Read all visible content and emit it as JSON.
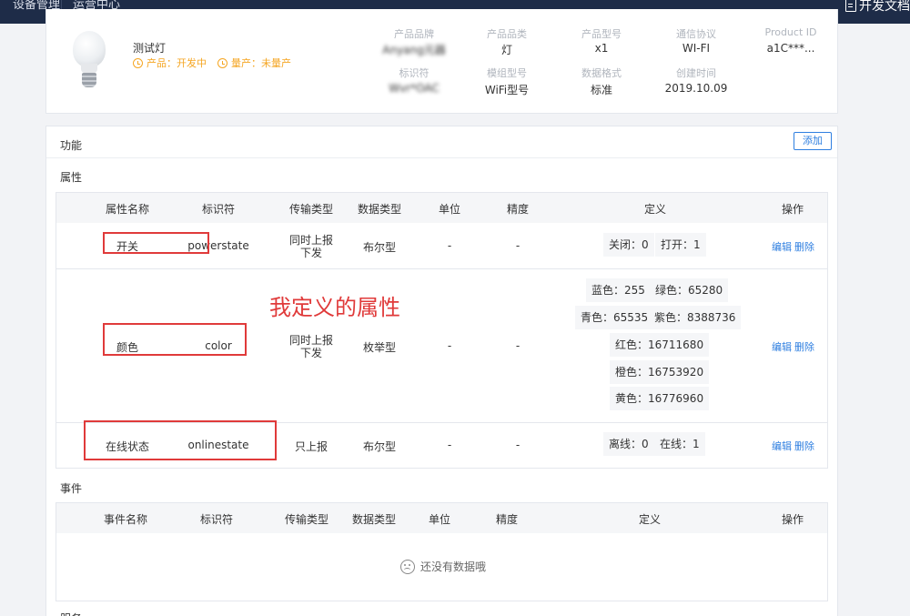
{
  "topbar": {
    "nav": [
      "设备管理",
      "运营中心"
    ],
    "doc_link": "开发文档"
  },
  "product": {
    "name": "测试灯",
    "status": [
      {
        "label": "产品：开发中"
      },
      {
        "label": "量产：未量产"
      }
    ],
    "meta": [
      {
        "label": "产品品牌",
        "value": "Anyang元器"
      },
      {
        "label": "产品品类",
        "value": "灯"
      },
      {
        "label": "产品型号",
        "value": "x1"
      },
      {
        "label": "通信协议",
        "value": "WI-FI"
      },
      {
        "label": "Product ID",
        "value": "a1C***..."
      },
      {
        "label": "标识符",
        "value": "Wvr*OAC"
      },
      {
        "label": "模组型号",
        "value": "WiFi型号"
      },
      {
        "label": "数据格式",
        "value": "标准"
      },
      {
        "label": "创建时间",
        "value": "2019.10.09"
      }
    ]
  },
  "functions": {
    "title": "功能",
    "add_label": "添加",
    "annotation": "我定义的属性",
    "properties": {
      "section": "属性",
      "headers": [
        "属性名称",
        "标识符",
        "传输类型",
        "数据类型",
        "单位",
        "精度",
        "定义",
        "操作"
      ],
      "rows": [
        {
          "name": "开关",
          "identifier": "powerstate",
          "transfer": "同时上报下发",
          "transfer_l1": "同时上报",
          "transfer_l2": "下发",
          "dtype": "布尔型",
          "unit": "-",
          "precision": "-",
          "definitions": [
            "关闭：0",
            "打开：1"
          ],
          "edit": "编辑",
          "delete": "删除"
        },
        {
          "name": "颜色",
          "identifier": "color",
          "transfer": "同时上报下发",
          "transfer_l1": "同时上报",
          "transfer_l2": "下发",
          "dtype": "枚举型",
          "unit": "-",
          "precision": "-",
          "definitions": [
            "蓝色：255",
            "绿色：65280",
            "青色：65535",
            "紫色：8388736",
            "红色：16711680",
            "橙色：16753920",
            "黄色：16776960"
          ],
          "edit": "编辑",
          "delete": "删除"
        },
        {
          "name": "在线状态",
          "identifier": "onlinestate",
          "transfer": "只上报",
          "dtype": "布尔型",
          "unit": "-",
          "precision": "-",
          "definitions": [
            "离线：0",
            "在线：1"
          ],
          "edit": "编辑",
          "delete": "删除"
        }
      ]
    },
    "events": {
      "section": "事件",
      "headers": [
        "事件名称",
        "标识符",
        "传输类型",
        "数据类型",
        "单位",
        "精度",
        "定义",
        "操作"
      ],
      "empty_text": "还没有数据哦"
    },
    "services": {
      "section": "服务"
    }
  }
}
